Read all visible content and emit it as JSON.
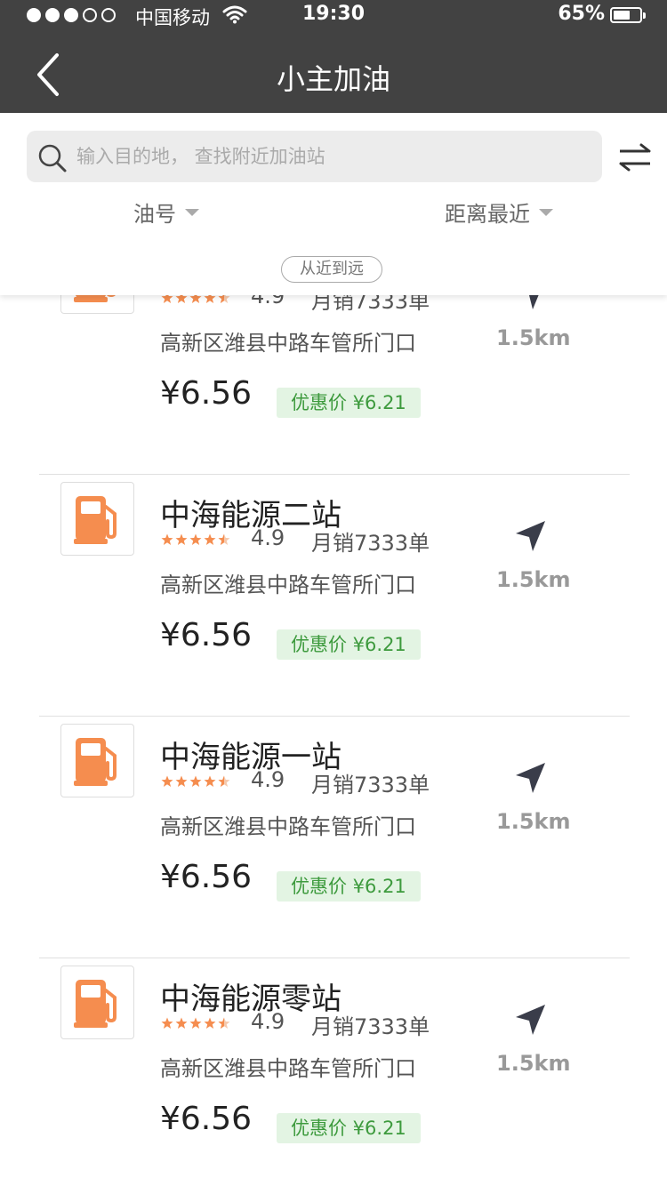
{
  "status": {
    "carrier": "中国移动",
    "time": "19:30",
    "battery": "65%",
    "battery_level": 0.65
  },
  "nav": {
    "title": "小主加油"
  },
  "search": {
    "placeholder": "输入目的地， 查找附近加油站"
  },
  "filters": {
    "fuel_label": "油号",
    "sort_label": "距离最近",
    "sort_chip": "从近到远"
  },
  "colors": {
    "accent": "#f58d4f",
    "discount_bg": "#e3f4e3",
    "discount_text": "#3d9a3d",
    "bar": "#424242"
  },
  "stations": [
    {
      "name": "",
      "rating": "4.9",
      "stars": 4.5,
      "sales": "月销7333单",
      "address": "高新区潍县中路车管所门口",
      "distance": "1.5km",
      "price": "¥6.56",
      "discount": "优惠价 ¥6.21"
    },
    {
      "name": "中海能源二站",
      "rating": "4.9",
      "stars": 4.5,
      "sales": "月销7333单",
      "address": "高新区潍县中路车管所门口",
      "distance": "1.5km",
      "price": "¥6.56",
      "discount": "优惠价 ¥6.21"
    },
    {
      "name": "中海能源一站",
      "rating": "4.9",
      "stars": 4.5,
      "sales": "月销7333单",
      "address": "高新区潍县中路车管所门口",
      "distance": "1.5km",
      "price": "¥6.56",
      "discount": "优惠价 ¥6.21"
    },
    {
      "name": "中海能源零站",
      "rating": "4.9",
      "stars": 4.5,
      "sales": "月销7333单",
      "address": "高新区潍县中路车管所门口",
      "distance": "1.5km",
      "price": "¥6.56",
      "discount": "优惠价 ¥6.21"
    }
  ]
}
